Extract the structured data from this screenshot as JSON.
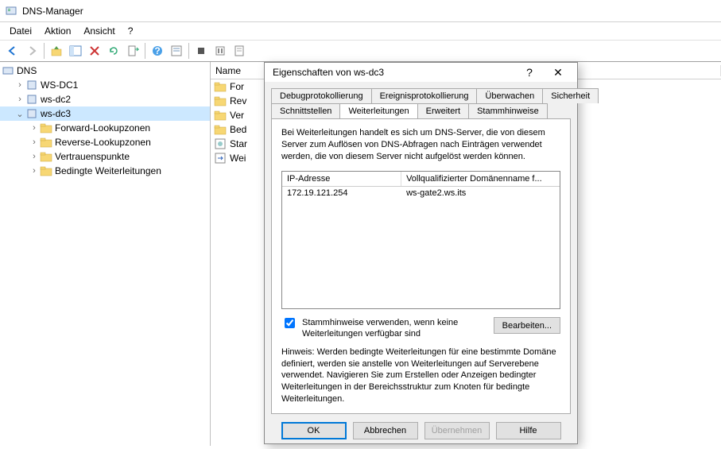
{
  "window": {
    "title": "DNS-Manager"
  },
  "menubar": {
    "items": [
      "Datei",
      "Aktion",
      "Ansicht",
      "?"
    ]
  },
  "tree": {
    "root": "DNS",
    "servers": [
      "WS-DC1",
      "ws-dc2",
      "ws-dc3"
    ],
    "selected": "ws-dc3",
    "children": [
      "Forward-Lookupzonen",
      "Reverse-Lookupzonen",
      "Vertrauenspunkte",
      "Bedingte Weiterleitungen"
    ]
  },
  "list": {
    "header": "Name",
    "rows": [
      "For",
      "Rev",
      "Ver",
      "Bed",
      "Star",
      "Wei"
    ]
  },
  "dialog": {
    "title": "Eigenschaften von ws-dc3",
    "tabs_row1": [
      "Debugprotokollierung",
      "Ereignisprotokollierung",
      "Überwachen",
      "Sicherheit"
    ],
    "tabs_row2": [
      "Schnittstellen",
      "Weiterleitungen",
      "Erweitert",
      "Stammhinweise"
    ],
    "active_tab": "Weiterleitungen",
    "description": "Bei Weiterleitungen handelt es sich um DNS-Server, die von diesem Server zum Auflösen von DNS-Abfragen nach Einträgen verwendet werden, die von diesem Server nicht aufgelöst werden können.",
    "forwarders": {
      "col_ip": "IP-Adresse",
      "col_fqdn": "Vollqualifizierter Domänenname f...",
      "rows": [
        {
          "ip": "172.19.121.254",
          "fqdn": "ws-gate2.ws.its"
        }
      ]
    },
    "checkbox_label": "Stammhinweise verwenden, wenn keine Weiterleitungen verfügbar sind",
    "checkbox_checked": true,
    "edit_button": "Bearbeiten...",
    "hint": "Hinweis: Werden bedingte Weiterleitungen für eine bestimmte Domäne definiert, werden sie anstelle von Weiterleitungen auf Serverebene verwendet. Navigieren Sie zum Erstellen oder Anzeigen bedingter Weiterleitungen in der Bereichsstruktur zum Knoten für bedingte Weiterleitungen.",
    "buttons": {
      "ok": "OK",
      "cancel": "Abbrechen",
      "apply": "Übernehmen",
      "help": "Hilfe"
    }
  }
}
